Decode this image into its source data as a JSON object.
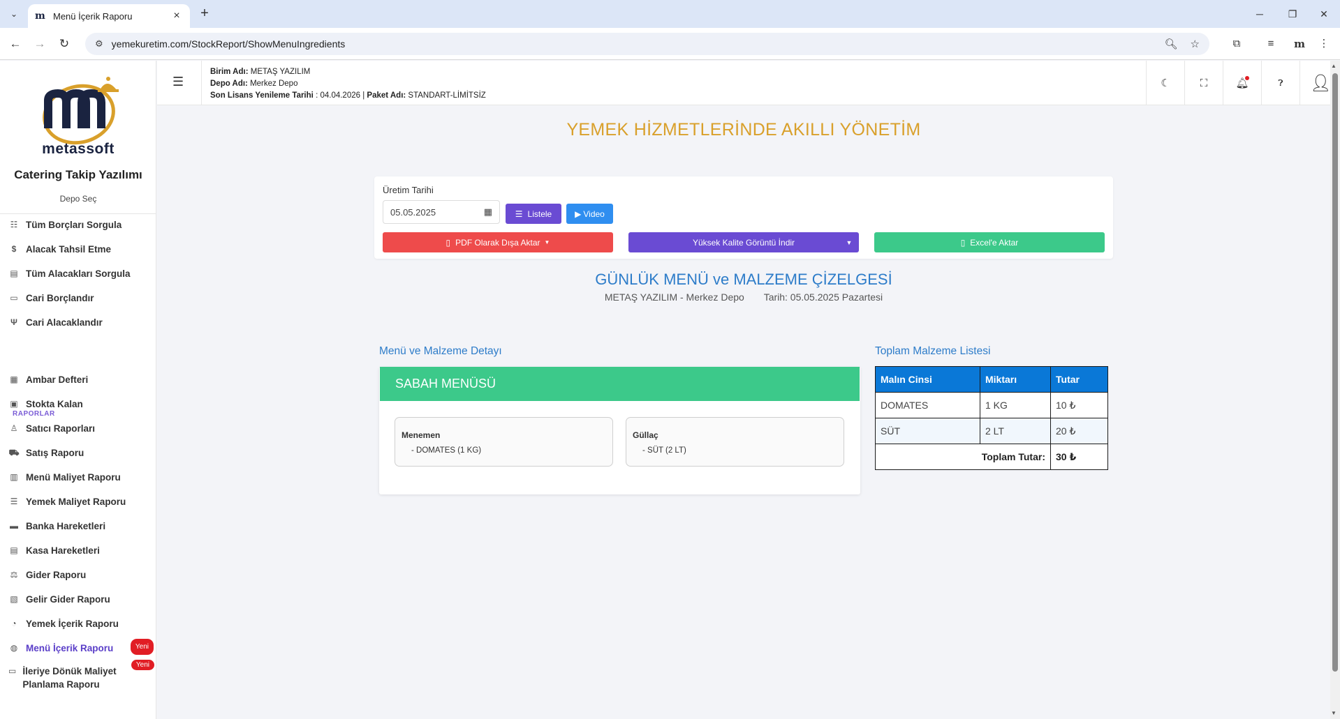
{
  "browser": {
    "tab_title": "Menü İçerik Raporu",
    "tab_favicon": "m",
    "url": "yemekuretim.com/StockReport/ShowMenuIngredients"
  },
  "sidebar": {
    "brand": "metassoft",
    "app_name": "Catering Takip Yazılımı",
    "depo_select": "Depo Seç",
    "items_top": [
      {
        "label": "Tüm Borçları Sorgula",
        "icon": "list-icon"
      },
      {
        "label": "Alacak Tahsil Etme",
        "icon": "hand-coin-icon"
      },
      {
        "label": "Tüm Alacakları Sorgula",
        "icon": "document-icon"
      },
      {
        "label": "Cari Borçlandır",
        "icon": "money-out-icon"
      },
      {
        "label": "Cari Alacaklandır",
        "icon": "money-in-icon"
      }
    ],
    "section_reports": "RAPORLAR",
    "items_reports": [
      {
        "label": "Ambar Defteri",
        "icon": "ledger-icon"
      },
      {
        "label": "Stokta Kalan",
        "icon": "box-icon"
      },
      {
        "label": "Satıcı Raporları",
        "icon": "user-report-icon"
      },
      {
        "label": "Satış Raporu",
        "icon": "cart-icon"
      },
      {
        "label": "Menü Maliyet Raporu",
        "icon": "table-icon"
      },
      {
        "label": "Yemek Maliyet Raporu",
        "icon": "list-detail-icon"
      },
      {
        "label": "Banka Hareketleri",
        "icon": "bank-icon"
      },
      {
        "label": "Kasa Hareketleri",
        "icon": "cashbox-icon"
      },
      {
        "label": "Gider Raporu",
        "icon": "expense-icon"
      },
      {
        "label": "Gelir Gider Raporu",
        "icon": "income-expense-icon"
      },
      {
        "label": "Yemek İçerik Raporu",
        "icon": "dish-icon"
      },
      {
        "label": "Menü İçerik Raporu",
        "icon": "menu-report-icon"
      },
      {
        "label": "İleriye Dönük Maliyet Planlama Raporu",
        "icon": "planning-icon"
      }
    ],
    "badge_new": "Yeni"
  },
  "header": {
    "birim_label": "Birim Adı:",
    "birim_value": "METAŞ YAZILIM",
    "depo_label": "Depo Adı:",
    "depo_value": "Merkez Depo",
    "lisans_label": "Son Lisans Yenileme Tarihi",
    "lisans_value": ": 04.04.2026 |",
    "paket_label": "Paket Adı:",
    "paket_value": "STANDART-LİMİTSİZ"
  },
  "main": {
    "slogan": "YEMEK HİZMETLERİNDE AKILLI YÖNETİM",
    "filter": {
      "date_label": "Üretim Tarihi",
      "date_value": "05.05.2025",
      "listele": "Listele",
      "video": "Video",
      "pdf": "PDF Olarak Dışa Aktar",
      "hq_image": "Yüksek Kalite Görüntü İndir",
      "excel": "Excel'e Aktar"
    },
    "schedule_title": "GÜNLÜK MENÜ ve MALZEME ÇİZELGESİ",
    "schedule_company": "METAŞ YAZILIM - Merkez Depo",
    "schedule_date": "Tarih: 05.05.2025 Pazartesi",
    "menu_section_title": "Menü ve Malzeme Detayı",
    "totals_section_title": "Toplam Malzeme Listesi",
    "menu_card": {
      "title": "SABAH MENÜSÜ",
      "dishes": [
        {
          "name": "Menemen",
          "ingredient": "- DOMATES (1 KG)"
        },
        {
          "name": "Güllaç",
          "ingredient": "- SÜT (2 LT)"
        }
      ]
    },
    "totals_table": {
      "headers": [
        "Malın Cinsi",
        "Miktarı",
        "Tutar"
      ],
      "rows": [
        [
          "DOMATES",
          "1 KG",
          "10 ₺"
        ],
        [
          "SÜT",
          "2 LT",
          "20 ₺"
        ]
      ],
      "total_label": "Toplam Tutar:",
      "total_value": "30 ₺"
    }
  },
  "colors": {
    "slogan": "#d9a02b",
    "accent_purple": "#6a4bd3",
    "pdf_red": "#ee4b4b",
    "excel_green": "#3cc98a",
    "table_header_blue": "#0a78d7",
    "title_blue": "#2d7cc9"
  }
}
